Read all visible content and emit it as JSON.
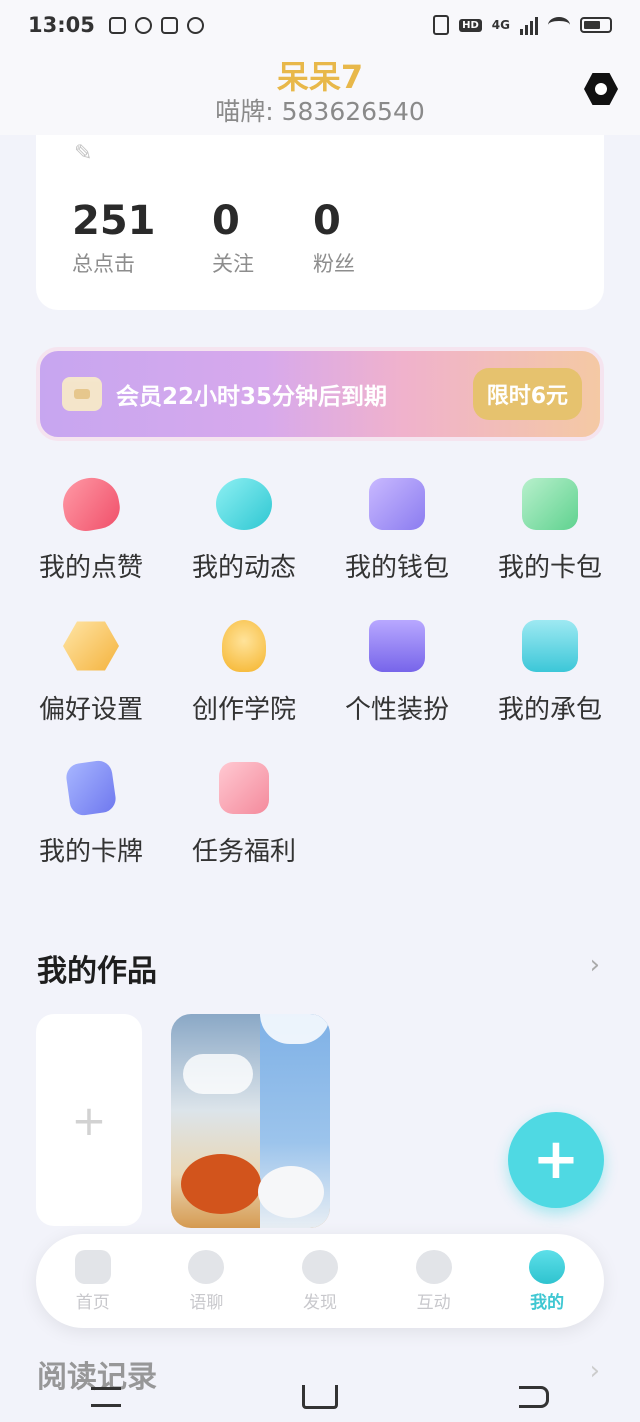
{
  "status_bar": {
    "time": "13:05",
    "hd": "HD",
    "network": "4G"
  },
  "header": {
    "user_name": "呆呆7",
    "user_id": "喵牌: 583626540"
  },
  "stats": [
    {
      "value": "251",
      "label": "总点击"
    },
    {
      "value": "0",
      "label": "关注"
    },
    {
      "value": "0",
      "label": "粉丝"
    }
  ],
  "vip": {
    "text": "会员22小时35分钟后到期",
    "button": "限时6元"
  },
  "grid": [
    {
      "label": "我的点赞",
      "icon": "heart-icon"
    },
    {
      "label": "我的动态",
      "icon": "dynamic-icon"
    },
    {
      "label": "我的钱包",
      "icon": "wallet-icon"
    },
    {
      "label": "我的卡包",
      "icon": "card-wallet-icon"
    },
    {
      "label": "偏好设置",
      "icon": "preference-icon"
    },
    {
      "label": "创作学院",
      "icon": "lightbulb-icon"
    },
    {
      "label": "个性装扮",
      "icon": "shop-icon"
    },
    {
      "label": "我的承包",
      "icon": "whale-icon"
    },
    {
      "label": "我的卡牌",
      "icon": "playing-card-icon"
    },
    {
      "label": "任务福利",
      "icon": "gift-bag-icon"
    }
  ],
  "works": {
    "title": "我的作品",
    "more": "›",
    "add": "+"
  },
  "fab": {
    "label": "+"
  },
  "tabs": [
    {
      "label": "首页",
      "icon": "home-icon"
    },
    {
      "label": "语聊",
      "icon": "chat-icon"
    },
    {
      "label": "发现",
      "icon": "discover-icon"
    },
    {
      "label": "互动",
      "icon": "interact-icon"
    },
    {
      "label": "我的",
      "icon": "profile-icon",
      "active": true
    }
  ],
  "reading": {
    "title": "阅读记录",
    "more": "›"
  },
  "colors": {
    "accent": "#4fd9e3",
    "gold": "#e8b84a",
    "vip_button": "#e6c26e"
  }
}
